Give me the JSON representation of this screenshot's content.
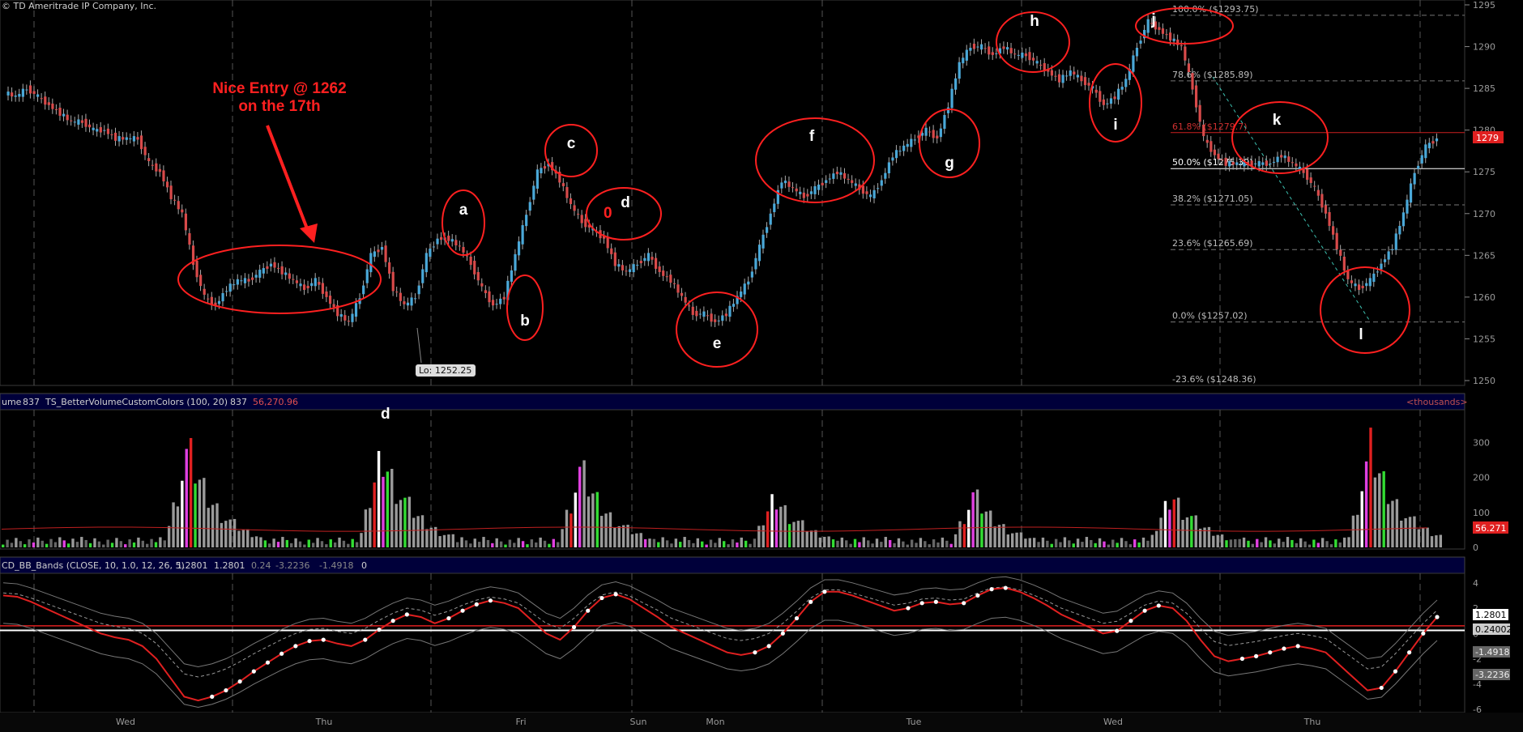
{
  "copyright": "© TD Ameritrade IP Company, Inc.",
  "panels": {
    "volume": {
      "header_name": "ume",
      "header_value1": "837",
      "study_name": "TS_BetterVolumeCustomColors (100, 20)",
      "study_value": "837",
      "study_avg": "56,270.96",
      "units_label": "<thousands>",
      "avg_badge": "56.271",
      "d_marker": "d"
    },
    "oscillator": {
      "header_name": "CD_BB_Bands (CLOSE, 10, 1.0, 12, 26, 5)",
      "values": [
        "1.2801",
        "1.2801",
        "0.24",
        "-3.2236",
        "-1.4918",
        "0"
      ],
      "badges": [
        "1.2801",
        "0.24002",
        "-1.4918",
        "-3.2236"
      ]
    }
  },
  "annotation": {
    "line1": "Nice Entry @ 1262",
    "line2": "on the 17th",
    "low_label": "Lo: 1252.25",
    "price_badge": "1279",
    "stray_zero": "0"
  },
  "colors": {
    "background": "#000000",
    "up_candle": "#4aa8d8",
    "down_candle": "#d84a4a",
    "annotation": "#ff2020",
    "grid": "#555555",
    "volume_gray": "#9a9a9a",
    "volume_magenta": "#e040e0",
    "volume_green": "#33dd33",
    "volume_red": "#e02020",
    "volume_white": "#ffffff"
  },
  "chart_data": [
    {
      "type": "candlestick",
      "panel": "price",
      "y_ticks": [
        1250,
        1255,
        1260,
        1265,
        1270,
        1275,
        1280,
        1285,
        1290,
        1295
      ],
      "ylim": [
        1250,
        1295
      ],
      "x_day_labels": [
        "Wed",
        "Thu",
        "Fri",
        "Sun",
        "Mon",
        "Tue",
        "Wed",
        "Thu"
      ],
      "closes_approx": [
        1284,
        1285,
        1284,
        1283,
        1282,
        1281,
        1281,
        1280,
        1280,
        1279,
        1279,
        1279,
        1276,
        1275,
        1272,
        1270,
        1264,
        1260,
        1259,
        1261,
        1262,
        1262,
        1263,
        1264,
        1263,
        1262,
        1261,
        1262,
        1260,
        1258,
        1257,
        1260,
        1265,
        1266,
        1261,
        1259,
        1260,
        1265,
        1267,
        1267,
        1266,
        1264,
        1261,
        1259,
        1260,
        1265,
        1270,
        1275,
        1276,
        1274,
        1271,
        1269,
        1268,
        1267,
        1264,
        1263,
        1264,
        1265,
        1263,
        1262,
        1260,
        1258,
        1258,
        1257,
        1258,
        1260,
        1262,
        1266,
        1270,
        1274,
        1273,
        1272,
        1273,
        1274,
        1275,
        1274,
        1273,
        1272,
        1274,
        1277,
        1278,
        1279,
        1280,
        1279,
        1283,
        1288,
        1290,
        1290,
        1289,
        1290,
        1289,
        1289,
        1288,
        1287,
        1286,
        1287,
        1286,
        1285,
        1283,
        1284,
        1286,
        1290,
        1293,
        1292,
        1291,
        1290,
        1285,
        1279,
        1277,
        1276,
        1276,
        1276,
        1276,
        1276,
        1277,
        1276,
        1275,
        1273,
        1270,
        1266,
        1262,
        1261,
        1262,
        1264,
        1266,
        1270,
        1275,
        1278,
        1279
      ],
      "fib_levels": [
        {
          "label": "100.0% ($1293.75)",
          "value": 1293.75
        },
        {
          "label": "78.6% ($1285.89)",
          "value": 1285.89
        },
        {
          "label": "61.8% ($1279.7)",
          "value": 1279.7
        },
        {
          "label": "50.0% ($1275.39)",
          "value": 1275.39
        },
        {
          "label": "38.2% ($1271.05)",
          "value": 1271.05
        },
        {
          "label": "23.6% ($1265.69)",
          "value": 1265.69
        },
        {
          "label": "0.0% ($1257.02)",
          "value": 1257.02
        },
        {
          "label": "-23.6% ($1248.36)",
          "value": 1248.36
        }
      ],
      "circle_labels": [
        "a",
        "b",
        "c",
        "d",
        "e",
        "f",
        "g",
        "h",
        "i",
        "j",
        "k",
        "l"
      ],
      "low": 1252.25
    },
    {
      "type": "bar",
      "panel": "volume",
      "y_ticks": [
        0,
        100,
        200,
        300
      ],
      "ylim": [
        0,
        380
      ],
      "spike_groups": [
        {
          "label": "",
          "peak": 360
        },
        {
          "label": "d",
          "peak": 350
        },
        {
          "label": "",
          "peak": 290
        },
        {
          "label": "",
          "peak": 190
        },
        {
          "label": "",
          "peak": 195
        },
        {
          "label": "",
          "peak": 200
        },
        {
          "label": "",
          "peak": 360
        }
      ]
    },
    {
      "type": "line",
      "panel": "oscillator",
      "y_ticks": [
        -6,
        -4,
        -2,
        0,
        2,
        4
      ],
      "ylim": [
        -6,
        4.5
      ],
      "series": [
        {
          "name": "",
          "values": [
            3.0,
            2.9,
            2.5,
            2.0,
            1.5,
            1.0,
            0.5,
            0.0,
            -0.3,
            -0.5,
            -1.0,
            -2.0,
            -3.5,
            -5.0,
            -5.3,
            -5.0,
            -4.5,
            -3.8,
            -3.0,
            -2.3,
            -1.6,
            -1.0,
            -0.6,
            -0.5,
            -0.8,
            -1.0,
            -0.5,
            0.3,
            1.0,
            1.5,
            1.3,
            0.8,
            1.2,
            1.8,
            2.3,
            2.6,
            2.4,
            2.0,
            1.0,
            0.0,
            -0.5,
            0.5,
            1.8,
            2.8,
            3.1,
            2.7,
            2.0,
            1.3,
            0.5,
            0.0,
            -0.5,
            -1.0,
            -1.5,
            -1.7,
            -1.5,
            -1.0,
            0.0,
            1.2,
            2.5,
            3.3,
            3.3,
            3.0,
            2.6,
            2.2,
            1.8,
            2.0,
            2.4,
            2.5,
            2.3,
            2.4,
            3.0,
            3.5,
            3.6,
            3.3,
            2.8,
            2.2,
            1.5,
            1.0,
            0.5,
            0.0,
            0.2,
            1.0,
            1.8,
            2.2,
            2.0,
            1.0,
            -0.5,
            -1.8,
            -2.2,
            -2.0,
            -1.8,
            -1.5,
            -1.2,
            -1.0,
            -1.2,
            -1.5,
            -2.5,
            -3.5,
            -4.5,
            -4.3,
            -3.0,
            -1.5,
            0.0,
            1.3
          ]
        }
      ]
    }
  ]
}
